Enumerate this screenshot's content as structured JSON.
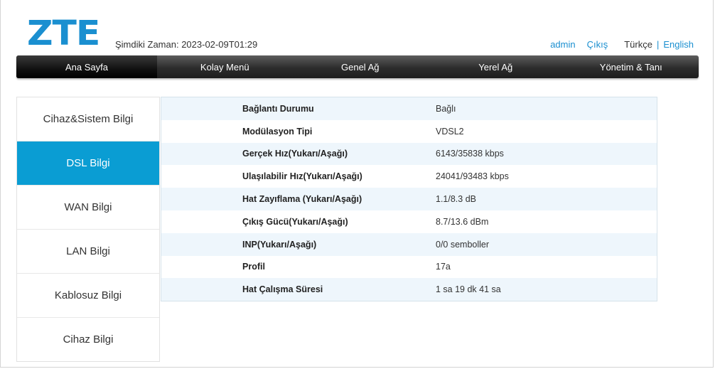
{
  "brand": {
    "logo_text": "ZTE",
    "accent_color": "#1a8fd0"
  },
  "header": {
    "time_label": "Şimdiki Zaman:",
    "time_value": "2023-02-09T01:29",
    "user": "admin",
    "logout": "Çıkış",
    "lang_current": "Türkçe",
    "lang_separator": "|",
    "lang_other": "English"
  },
  "nav": {
    "tabs": [
      {
        "label": "Ana Sayfa"
      },
      {
        "label": "Kolay Menü"
      },
      {
        "label": "Genel Ağ"
      },
      {
        "label": "Yerel Ağ"
      },
      {
        "label": "Yönetim & Tanı"
      }
    ],
    "active_index": 0
  },
  "sidebar": {
    "items": [
      {
        "label": "Cihaz&Sistem Bilgi"
      },
      {
        "label": "DSL Bilgi"
      },
      {
        "label": "WAN Bilgi"
      },
      {
        "label": "LAN Bilgi"
      },
      {
        "label": "Kablosuz Bilgi"
      },
      {
        "label": "Cihaz Bilgi"
      }
    ],
    "active_index": 1,
    "active_color": "#0a9dd3"
  },
  "dsl": {
    "rows": [
      {
        "label": "Bağlantı Durumu",
        "value": "Bağlı"
      },
      {
        "label": "Modülasyon Tipi",
        "value": "VDSL2"
      },
      {
        "label": "Gerçek Hız(Yukarı/Aşağı)",
        "value": "6143/35838 kbps"
      },
      {
        "label": "Ulaşılabilir Hız(Yukarı/Aşağı)",
        "value": "24041/93483 kbps"
      },
      {
        "label": "Hat Zayıflama (Yukarı/Aşağı)",
        "value": "1.1/8.3 dB"
      },
      {
        "label": "Çıkış Gücü(Yukarı/Aşağı)",
        "value": "8.7/13.6 dBm"
      },
      {
        "label": "INP(Yukarı/Aşağı)",
        "value": "0/0 semboller"
      },
      {
        "label": "Profil",
        "value": "17a"
      },
      {
        "label": "Hat Çalışma Süresi",
        "value": "1 sa 19 dk 41 sa"
      }
    ]
  }
}
